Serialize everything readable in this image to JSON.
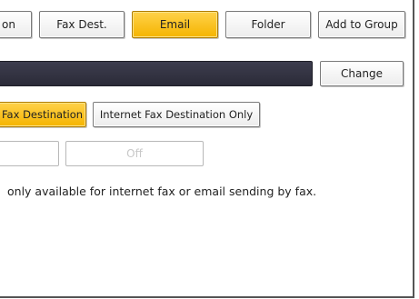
{
  "tabs": {
    "partial_left": "on",
    "fax_dest": "Fax Dest.",
    "email": "Email",
    "folder": "Folder",
    "add_to_group": "Add to Group"
  },
  "destination": {
    "change_label": "Change"
  },
  "fax_options": {
    "fax_destination_partial": "Fax Destination",
    "internet_fax_only": "Internet Fax Destination Only"
  },
  "toggle": {
    "off_label": "Off"
  },
  "message": "only available for internet fax or email sending by fax."
}
